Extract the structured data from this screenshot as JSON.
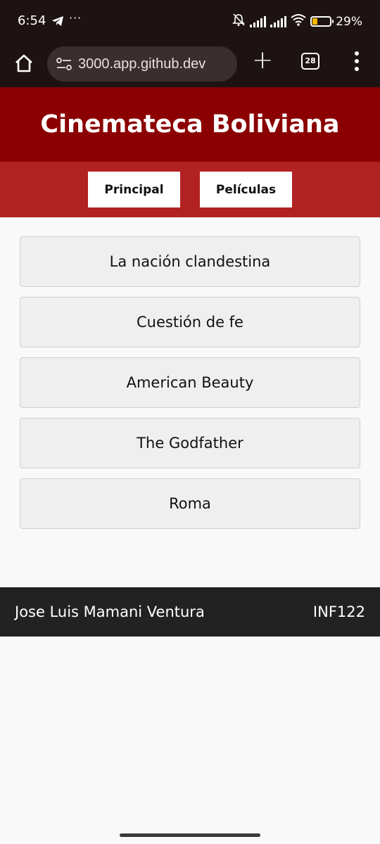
{
  "status_bar": {
    "time": "6:54",
    "overflow": "···",
    "battery_percent": "29%",
    "battery_level": 0.29,
    "icons": [
      "telegram-icon",
      "mute-icon",
      "signal-icon",
      "signal-icon",
      "wifi-icon",
      "battery-icon"
    ]
  },
  "browser": {
    "url": "3000.app.github.dev",
    "new_tab_symbol": "+",
    "tab_count": "28"
  },
  "site": {
    "title": "Cinemateca Boliviana",
    "nav": [
      {
        "label": "Principal"
      },
      {
        "label": "Películas"
      }
    ],
    "movies": [
      "La nación clandestina",
      "Cuestión de fe",
      "American Beauty",
      "The Godfather",
      "Roma"
    ],
    "footer": {
      "author": "Jose Luis Mamani Ventura",
      "course": "INF122"
    }
  },
  "colors": {
    "header": "#8b0000",
    "nav": "#b22222",
    "footer": "#222222",
    "browser_chrome": "#1e1313"
  }
}
